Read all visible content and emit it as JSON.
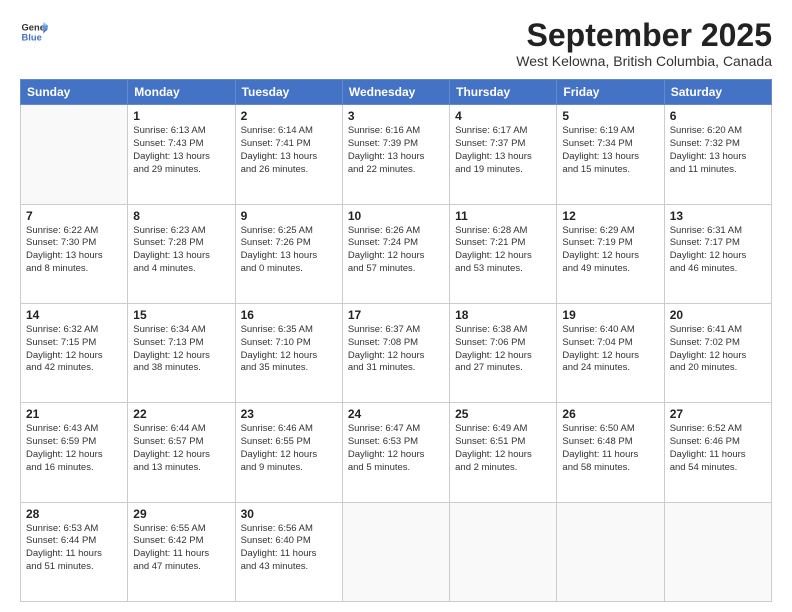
{
  "header": {
    "logo_line1": "General",
    "logo_line2": "Blue",
    "month": "September 2025",
    "location": "West Kelowna, British Columbia, Canada"
  },
  "weekdays": [
    "Sunday",
    "Monday",
    "Tuesday",
    "Wednesday",
    "Thursday",
    "Friday",
    "Saturday"
  ],
  "weeks": [
    [
      {
        "day": "",
        "info": ""
      },
      {
        "day": "1",
        "info": "Sunrise: 6:13 AM\nSunset: 7:43 PM\nDaylight: 13 hours\nand 29 minutes."
      },
      {
        "day": "2",
        "info": "Sunrise: 6:14 AM\nSunset: 7:41 PM\nDaylight: 13 hours\nand 26 minutes."
      },
      {
        "day": "3",
        "info": "Sunrise: 6:16 AM\nSunset: 7:39 PM\nDaylight: 13 hours\nand 22 minutes."
      },
      {
        "day": "4",
        "info": "Sunrise: 6:17 AM\nSunset: 7:37 PM\nDaylight: 13 hours\nand 19 minutes."
      },
      {
        "day": "5",
        "info": "Sunrise: 6:19 AM\nSunset: 7:34 PM\nDaylight: 13 hours\nand 15 minutes."
      },
      {
        "day": "6",
        "info": "Sunrise: 6:20 AM\nSunset: 7:32 PM\nDaylight: 13 hours\nand 11 minutes."
      }
    ],
    [
      {
        "day": "7",
        "info": "Sunrise: 6:22 AM\nSunset: 7:30 PM\nDaylight: 13 hours\nand 8 minutes."
      },
      {
        "day": "8",
        "info": "Sunrise: 6:23 AM\nSunset: 7:28 PM\nDaylight: 13 hours\nand 4 minutes."
      },
      {
        "day": "9",
        "info": "Sunrise: 6:25 AM\nSunset: 7:26 PM\nDaylight: 13 hours\nand 0 minutes."
      },
      {
        "day": "10",
        "info": "Sunrise: 6:26 AM\nSunset: 7:24 PM\nDaylight: 12 hours\nand 57 minutes."
      },
      {
        "day": "11",
        "info": "Sunrise: 6:28 AM\nSunset: 7:21 PM\nDaylight: 12 hours\nand 53 minutes."
      },
      {
        "day": "12",
        "info": "Sunrise: 6:29 AM\nSunset: 7:19 PM\nDaylight: 12 hours\nand 49 minutes."
      },
      {
        "day": "13",
        "info": "Sunrise: 6:31 AM\nSunset: 7:17 PM\nDaylight: 12 hours\nand 46 minutes."
      }
    ],
    [
      {
        "day": "14",
        "info": "Sunrise: 6:32 AM\nSunset: 7:15 PM\nDaylight: 12 hours\nand 42 minutes."
      },
      {
        "day": "15",
        "info": "Sunrise: 6:34 AM\nSunset: 7:13 PM\nDaylight: 12 hours\nand 38 minutes."
      },
      {
        "day": "16",
        "info": "Sunrise: 6:35 AM\nSunset: 7:10 PM\nDaylight: 12 hours\nand 35 minutes."
      },
      {
        "day": "17",
        "info": "Sunrise: 6:37 AM\nSunset: 7:08 PM\nDaylight: 12 hours\nand 31 minutes."
      },
      {
        "day": "18",
        "info": "Sunrise: 6:38 AM\nSunset: 7:06 PM\nDaylight: 12 hours\nand 27 minutes."
      },
      {
        "day": "19",
        "info": "Sunrise: 6:40 AM\nSunset: 7:04 PM\nDaylight: 12 hours\nand 24 minutes."
      },
      {
        "day": "20",
        "info": "Sunrise: 6:41 AM\nSunset: 7:02 PM\nDaylight: 12 hours\nand 20 minutes."
      }
    ],
    [
      {
        "day": "21",
        "info": "Sunrise: 6:43 AM\nSunset: 6:59 PM\nDaylight: 12 hours\nand 16 minutes."
      },
      {
        "day": "22",
        "info": "Sunrise: 6:44 AM\nSunset: 6:57 PM\nDaylight: 12 hours\nand 13 minutes."
      },
      {
        "day": "23",
        "info": "Sunrise: 6:46 AM\nSunset: 6:55 PM\nDaylight: 12 hours\nand 9 minutes."
      },
      {
        "day": "24",
        "info": "Sunrise: 6:47 AM\nSunset: 6:53 PM\nDaylight: 12 hours\nand 5 minutes."
      },
      {
        "day": "25",
        "info": "Sunrise: 6:49 AM\nSunset: 6:51 PM\nDaylight: 12 hours\nand 2 minutes."
      },
      {
        "day": "26",
        "info": "Sunrise: 6:50 AM\nSunset: 6:48 PM\nDaylight: 11 hours\nand 58 minutes."
      },
      {
        "day": "27",
        "info": "Sunrise: 6:52 AM\nSunset: 6:46 PM\nDaylight: 11 hours\nand 54 minutes."
      }
    ],
    [
      {
        "day": "28",
        "info": "Sunrise: 6:53 AM\nSunset: 6:44 PM\nDaylight: 11 hours\nand 51 minutes."
      },
      {
        "day": "29",
        "info": "Sunrise: 6:55 AM\nSunset: 6:42 PM\nDaylight: 11 hours\nand 47 minutes."
      },
      {
        "day": "30",
        "info": "Sunrise: 6:56 AM\nSunset: 6:40 PM\nDaylight: 11 hours\nand 43 minutes."
      },
      {
        "day": "",
        "info": ""
      },
      {
        "day": "",
        "info": ""
      },
      {
        "day": "",
        "info": ""
      },
      {
        "day": "",
        "info": ""
      }
    ]
  ]
}
